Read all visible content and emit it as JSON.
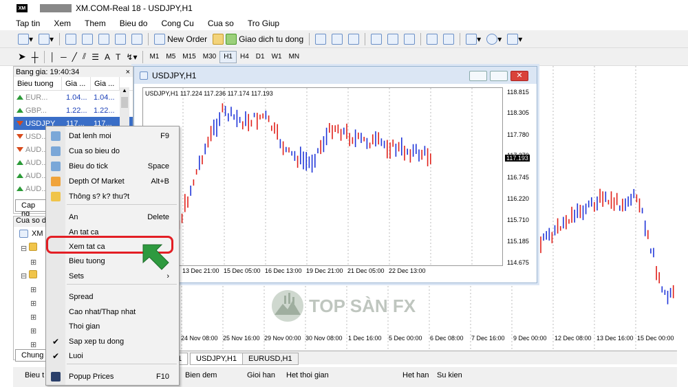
{
  "app": {
    "title": "XM.COM-Real 18 - USDJPY,H1",
    "logo_text": "XM"
  },
  "menu": [
    "Tap tin",
    "Xem",
    "Them",
    "Bieu do",
    "Cong Cu",
    "Cua so",
    "Tro Giup"
  ],
  "toolbar1": {
    "new_order": "New Order",
    "auto_trade": "Giao dich tu dong"
  },
  "toolbar2": {
    "text_tool": "A",
    "timeframes": [
      "M1",
      "M5",
      "M15",
      "M30",
      "H1",
      "H4",
      "D1",
      "W1",
      "MN"
    ],
    "active_tf": "H1"
  },
  "market_watch": {
    "header": "Bang gia: 19:40:34",
    "close": "×",
    "columns": [
      "Bieu tuong",
      "Gia ...",
      "Gia ..."
    ],
    "rows": [
      {
        "symbol": "EUR...",
        "bid": "1.04...",
        "ask": "1.04...",
        "dir": "up"
      },
      {
        "symbol": "GBP...",
        "bid": "1.22...",
        "ask": "1.22...",
        "dir": "up"
      },
      {
        "symbol": "USDJPY",
        "bid": "117...",
        "ask": "117...",
        "dir": "dn",
        "selected": true
      },
      {
        "symbol": "USD...",
        "bid": "",
        "ask": "",
        "dir": "dn"
      },
      {
        "symbol": "AUD...",
        "bid": "",
        "ask": "",
        "dir": "dn"
      },
      {
        "symbol": "AUD...",
        "bid": "",
        "ask": "",
        "dir": "up"
      },
      {
        "symbol": "AUD...",
        "bid": "",
        "ask": "",
        "dir": "up"
      },
      {
        "symbol": "AUD...",
        "bid": "",
        "ask": "",
        "dir": "up"
      }
    ],
    "tab": "Cap ng"
  },
  "navigator": {
    "header": "Cua so di",
    "root": "XM",
    "tab": "Chung"
  },
  "chart_window": {
    "title": "USDJPY,H1",
    "info": "USDJPY,H1  117.224 117.236 117.174 117.193",
    "y_labels": [
      "118.815",
      "118.305",
      "117.780",
      "117.270",
      "116.745",
      "116.220",
      "115.710",
      "115.185",
      "114.675"
    ],
    "current_price": "117.193",
    "x_labels": [
      "13 Dec 21:00",
      "15 Dec 05:00",
      "16 Dec 13:00",
      "19 Dec 21:00",
      "21 Dec 05:00",
      "22 Dec 13:00"
    ]
  },
  "bg_chart": {
    "x_labels": [
      "24 Nov 08:00",
      "25 Nov 16:00",
      "29 Nov 00:00",
      "30 Nov 08:00",
      "1 Dec 16:00",
      "5 Dec 00:00",
      "6 Dec 08:00",
      "7 Dec 16:00",
      "9 Dec 00:00",
      "12 Dec 08:00",
      "13 Dec 16:00",
      "15 Dec 00:00"
    ]
  },
  "context_menu": [
    {
      "label": "Dat lenh moi",
      "key": "F9",
      "icon": "new-order-icon"
    },
    {
      "label": "Cua so bieu do",
      "key": "",
      "icon": "chart-window-icon"
    },
    {
      "label": "Bieu do tick",
      "key": "Space",
      "icon": "tick-chart-icon"
    },
    {
      "label": "Depth Of Market",
      "key": "Alt+B",
      "icon": "depth-of-market-icon"
    },
    {
      "label": "Thông s? k? thu?t",
      "key": "",
      "icon": "specification-icon"
    },
    {
      "label": "An",
      "key": "Delete",
      "icon": ""
    },
    {
      "label": "An tat ca",
      "key": "",
      "icon": ""
    },
    {
      "label": "Xem tat ca",
      "key": "",
      "icon": "",
      "highlighted": true
    },
    {
      "label": "Bieu tuong",
      "key": "",
      "icon": ""
    },
    {
      "label": "Sets",
      "key": "›",
      "icon": ""
    },
    {
      "label": "Spread",
      "key": "",
      "icon": ""
    },
    {
      "label": "Cao nhat/Thap nhat",
      "key": "",
      "icon": ""
    },
    {
      "label": "Thoi gian",
      "key": "",
      "icon": ""
    },
    {
      "label": "Sap xep tu dong",
      "key": "",
      "icon": "check-icon"
    },
    {
      "label": "Luoi",
      "key": "",
      "icon": "check-icon"
    },
    {
      "label": "Popup Prices",
      "key": "F10",
      "icon": "popup-prices-icon"
    }
  ],
  "bottom_tabs": [
    "1",
    "USDJPY,H1",
    "EURUSD,H1"
  ],
  "active_bottom_tab": "USDJPY,H1",
  "terminal_columns": [
    "Bieu t",
    "Bien dem",
    "Gioi han",
    "Het thoi gian",
    "Het han",
    "Su kien"
  ],
  "watermark": "TOP SÀN FX",
  "colors": {
    "bull": "#1f35d8",
    "bear": "#e0201a",
    "highlight_ring": "#e31e24",
    "arrow": "#2e9a3f",
    "selected_row": "#3a6ec7"
  }
}
